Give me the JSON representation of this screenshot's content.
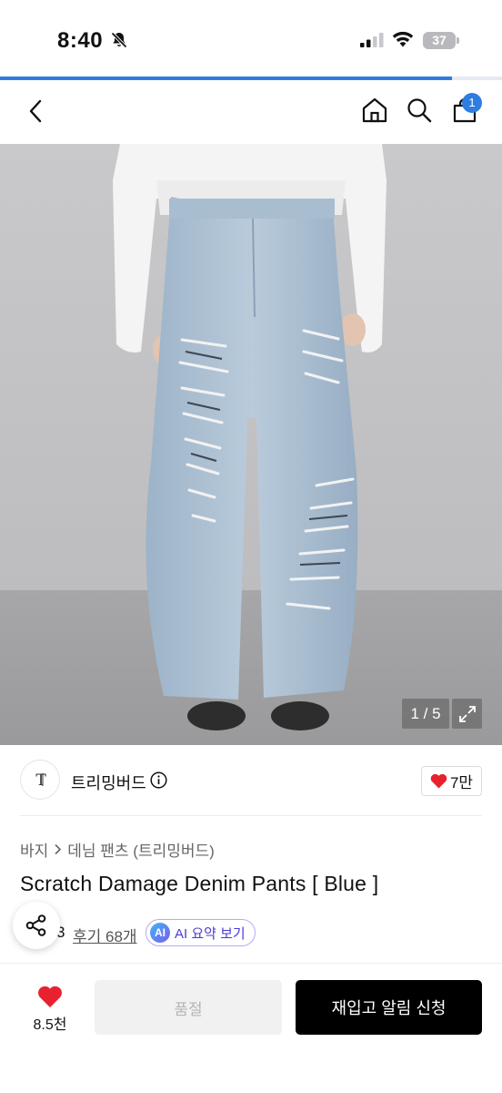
{
  "status_bar": {
    "time": "8:40",
    "battery": "37"
  },
  "page_progress": 0.9,
  "nav": {
    "cart_count": "1"
  },
  "gallery": {
    "counter": "1 / 5",
    "image_description_icon": "product-photo"
  },
  "brand": {
    "logo_text": "TB",
    "name": "트리밍버드",
    "like_count": "7만"
  },
  "breadcrumb": {
    "category": "바지",
    "subcategory": "데님 팬츠 (트리밍버드)"
  },
  "product": {
    "title": "Scratch Damage Denim Pants [ Blue ]",
    "rating_partial": "3",
    "review_label": "후기 68개",
    "ai_badge": "AI",
    "ai_summary_label": "AI 요약 보기"
  },
  "bottom_bar": {
    "wish_count": "8.5천",
    "soldout_label": "품절",
    "restock_label": "재입고 알림 신청"
  },
  "colors": {
    "accent": "#2f7de1",
    "heart": "#e8212e",
    "cta_bg": "#000000",
    "ai_text": "#4b3bd6"
  }
}
